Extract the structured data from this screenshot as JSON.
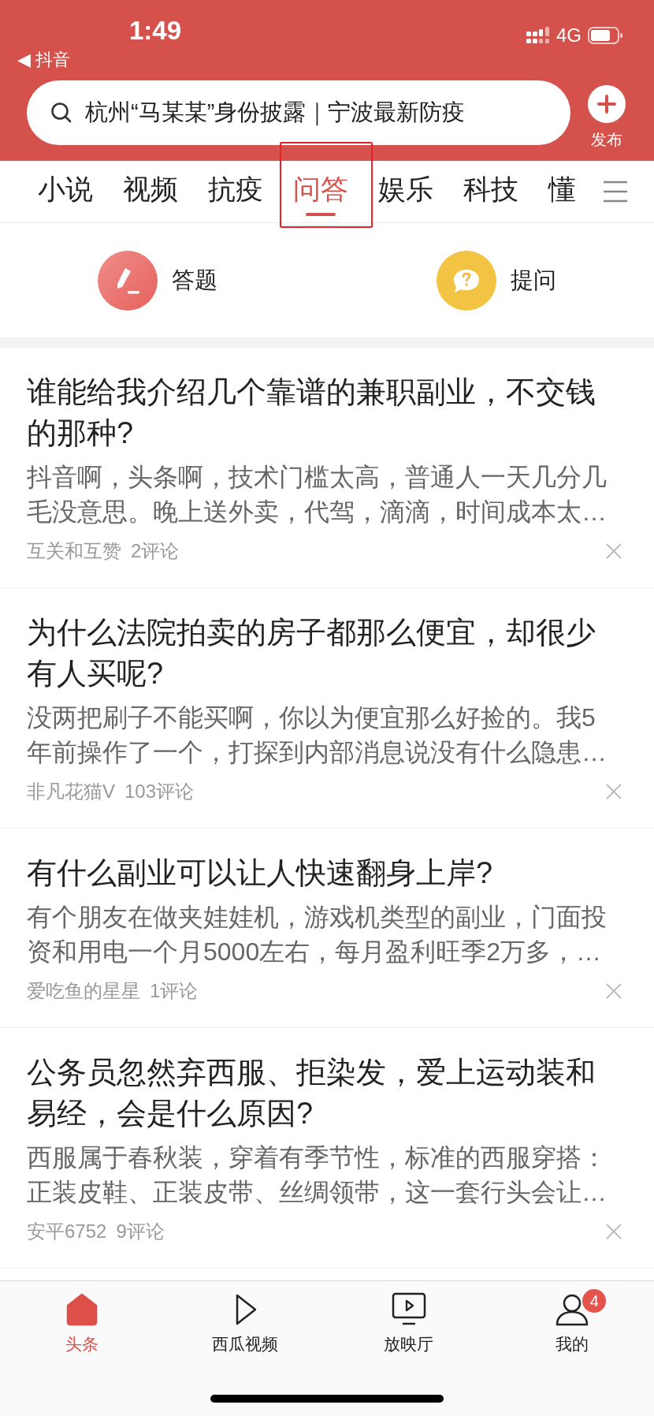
{
  "status_bar": {
    "time": "1:49",
    "back_app": "◀ 抖音",
    "network": "4G"
  },
  "search": {
    "value": "杭州“马某某”身份披露｜宁波最新防疫"
  },
  "publish_button": {
    "label": "发布"
  },
  "tabs": [
    {
      "label": "小说",
      "selected": false,
      "highlighted": false
    },
    {
      "label": "视频",
      "selected": false,
      "highlighted": false
    },
    {
      "label": "抗疫",
      "selected": false,
      "highlighted": false
    },
    {
      "label": "问答",
      "selected": true,
      "highlighted": true
    },
    {
      "label": "娱乐",
      "selected": false,
      "highlighted": false
    },
    {
      "label": "科技",
      "selected": false,
      "highlighted": false
    },
    {
      "label": "懂",
      "selected": false,
      "highlighted": false
    }
  ],
  "actions": [
    {
      "kind": "answer",
      "label": "答题"
    },
    {
      "kind": "ask",
      "label": "提问"
    }
  ],
  "questions": [
    {
      "title": "谁能给我介绍几个靠谱的兼职副业，不交钱的那种?",
      "snippet": "抖音啊，头条啊，技术门槛太高，普通人一天几分几毛没意思。晚上送外卖，代驾，滴滴，时间成本太…",
      "author": "互关和互赞",
      "comments": "2评论"
    },
    {
      "title": "为什么法院拍卖的房子都那么便宜，却很少有人买呢?",
      "snippet": "没两把刷子不能买啊，你以为便宜那么好捡的。我5年前操作了一个，打探到内部消息说没有什么隐患…",
      "author": "非凡花猫V",
      "comments": "103评论"
    },
    {
      "title": "有什么副业可以让人快速翻身上岸?",
      "snippet": "有个朋友在做夹娃娃机，游戏机类型的副业，门面投资和用电一个月5000左右，每月盈利旺季2万多，…",
      "author": "爱吃鱼的星星",
      "comments": "1评论"
    },
    {
      "title": "公务员忽然弃西服、拒染发，爱上运动装和易经，会是什么原因?",
      "snippet": "西服属于春秋装，穿着有季节性，标准的西服穿搭：正装皮鞋、正装皮带、丝绸领带，这一套行头会让…",
      "author": "安平6752",
      "comments": "9评论"
    }
  ],
  "bottom_nav": [
    {
      "kind": "home",
      "label": "头条",
      "selected": true
    },
    {
      "kind": "play",
      "label": "西瓜视频",
      "selected": false
    },
    {
      "kind": "tv",
      "label": "放映厅",
      "selected": false
    },
    {
      "kind": "profile",
      "label": "我的",
      "selected": false,
      "badge": "4"
    }
  ]
}
